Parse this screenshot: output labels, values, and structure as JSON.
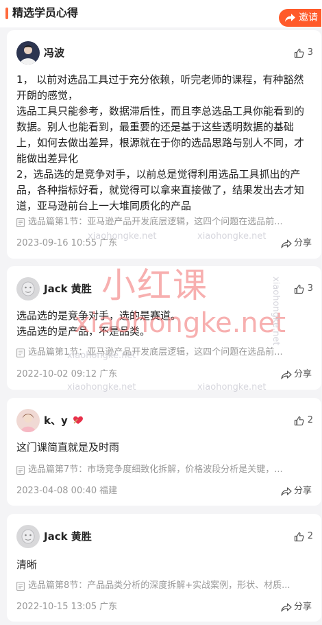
{
  "header": {
    "title": "精选学员心得",
    "invite_label": "邀请"
  },
  "posts": [
    {
      "user": "冯波",
      "likes": "3",
      "content": "1， 以前对选品工具过于充分依赖，听完老师的课程，有种豁然开朗的感觉，\n选品工具只能参考，数据滞后性，而且李总选品工具你能看到的数据。别人也能看到，最重要的还是基于这些透明数据的基础上，如何去做出差异，根源就在于你的选品思路与别人不同，才能做出差异化\n2，选品选的是竞争对手，以前总是觉得利用选品工具抓出的产品，各种指标好看，就觉得可以拿来直接做了，结果发出去才知道，亚马逊前台上一大堆同质化的产品",
      "source": "选品篇第1节：亚马逊产品开发底层逻辑，这四个问题在选品前...",
      "date": "2023-09-16 10:55",
      "location": "广东",
      "share_label": "分享"
    },
    {
      "user": "Jack 黄胜",
      "likes": "3",
      "content": "选品选的是竞争对手，选的是赛道。\n选品选的是产品，不是品类。",
      "source": "选品篇第1节：亚马逊产品开发底层逻辑，这四个问题在选品前...",
      "date": "2022-10-02 09:12",
      "location": "广东",
      "share_label": "分享"
    },
    {
      "user": "k、y",
      "likes": "2",
      "content": "这门课简直就是及时雨",
      "source": "选品篇第7节：市场竞争度细致化拆解，价格波段分析是关键，...",
      "date": "2023-04-08 00:40",
      "location": "福建",
      "share_label": "分享"
    },
    {
      "user": "Jack 黄胜",
      "likes": "2",
      "content": "清晰",
      "source": "选品篇第8节：产品品类分析的深度拆解+实战案例，形状、材质...",
      "date": "2022-10-15 13:05",
      "location": "广东",
      "share_label": "分享"
    }
  ],
  "watermarks": {
    "brand_cn": "小红课",
    "brand_en": "xiaohongke.net",
    "small": "xiaohongke.net"
  },
  "colors": {
    "accent": "#ff5a2a",
    "bar": "#ff6a3d",
    "background": "#f4f4f6"
  },
  "icons": [
    "share-arrow-icon",
    "thumb-up-icon",
    "document-icon",
    "share-icon"
  ]
}
